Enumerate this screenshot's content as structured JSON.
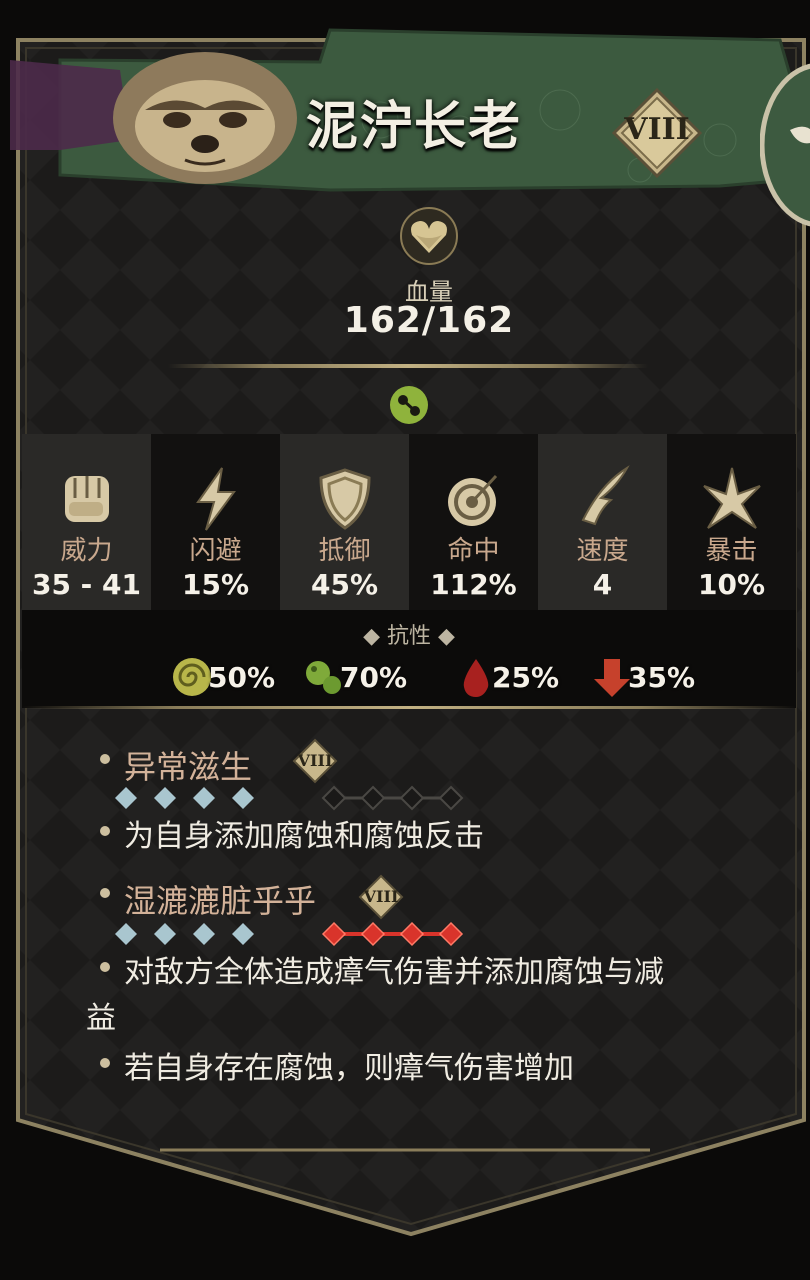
{
  "character": {
    "name": "泥泞长老",
    "rank": "VIII"
  },
  "health": {
    "label": "血量",
    "value": "162/162"
  },
  "stats": [
    {
      "icon": "fist-icon",
      "label": "威力",
      "value": "35 - 41"
    },
    {
      "icon": "lightning-icon",
      "label": "闪避",
      "value": "15%"
    },
    {
      "icon": "shield-icon",
      "label": "抵御",
      "value": "45%"
    },
    {
      "icon": "target-icon",
      "label": "命中",
      "value": "112%"
    },
    {
      "icon": "wing-icon",
      "label": "速度",
      "value": "4"
    },
    {
      "icon": "burst-icon",
      "label": "暴击",
      "value": "10%"
    }
  ],
  "resistances": {
    "title": "◆ 抗性 ◆",
    "items": [
      {
        "icon": "poison-swirl-icon",
        "value": "50%"
      },
      {
        "icon": "disease-icon",
        "value": "70%"
      },
      {
        "icon": "bleed-icon",
        "value": "25%"
      },
      {
        "icon": "debuff-icon",
        "value": "35%"
      }
    ]
  },
  "skills": [
    {
      "name": "异常滋生",
      "rank": "VIII",
      "position_pips": 4,
      "target_pips_active": 0,
      "target_pips_total": 4,
      "descriptions": [
        "为自身添加腐蚀和腐蚀反击"
      ]
    },
    {
      "name": "湿漉漉脏乎乎",
      "rank": "VIII",
      "position_pips": 4,
      "target_pips_active": 4,
      "target_pips_total": 4,
      "descriptions": [
        "对敌方全体造成瘴气伤害并添加腐蚀与减",
        "益",
        "若自身存在腐蚀，则瘴气伤害增加"
      ]
    }
  ],
  "colors": {
    "banner": "#3c5a3f",
    "frame": "#8d8261",
    "stat_label": "#c9a88d",
    "skill_name": "#d3b299",
    "position_pip": "#a9c6cf",
    "target_pip_active": "#d9342b"
  }
}
